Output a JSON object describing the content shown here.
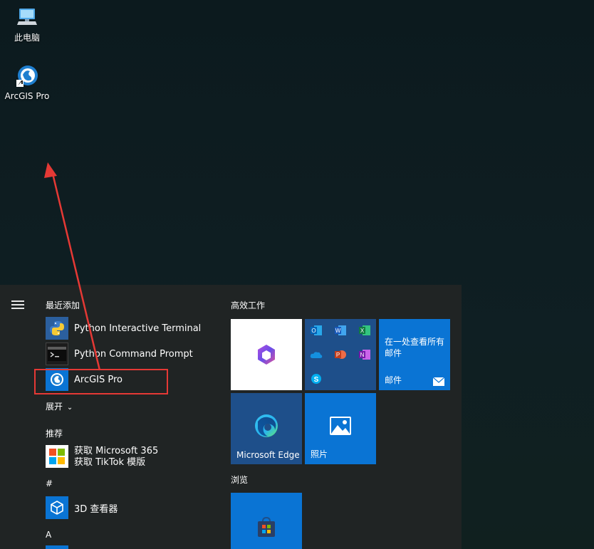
{
  "desktop": {
    "icons": [
      {
        "label": "此电脑",
        "icon": "computer-icon"
      },
      {
        "label": "ArcGIS Pro",
        "icon": "arcgis-globe-icon"
      }
    ]
  },
  "start_menu": {
    "recently_added_header": "最近添加",
    "recent_apps": [
      {
        "label": "Python Interactive Terminal",
        "icon": "python-icon"
      },
      {
        "label": "Python Command Prompt",
        "icon": "command-prompt-icon"
      },
      {
        "label": "ArcGIS Pro",
        "icon": "arcgis-globe-icon"
      }
    ],
    "expand_label": "展开",
    "recommended_header": "推荐",
    "recommended": [
      {
        "label": "获取 Microsoft 365",
        "icon": "microsoft-logo-icon"
      },
      {
        "label": "获取 TikTok 模版",
        "icon": "microsoft-logo-icon"
      }
    ],
    "hash_header": "#",
    "hash_apps": [
      {
        "label": "3D 查看器",
        "icon": "3d-cube-icon"
      }
    ],
    "a_header": "A",
    "tiles": {
      "group1_header": "高效工作",
      "mail_tile_text": "在一处查看所有邮件",
      "mail_label": "邮件",
      "edge_label": "Microsoft Edge",
      "photos_label": "照片",
      "group2_header": "浏览"
    }
  },
  "colors": {
    "tile_blue": "#0a74d4",
    "tile_dark_blue": "#1e4f8a",
    "menu_bg": "#202424",
    "highlight_red": "#e53935"
  }
}
